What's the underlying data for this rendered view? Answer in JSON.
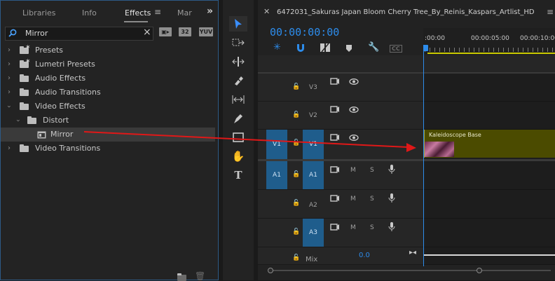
{
  "effects_panel": {
    "tabs": [
      "Libraries",
      "Info",
      "Effects",
      "Mar"
    ],
    "overflow_icon": "chevrons-right",
    "search": {
      "value": "Mirror",
      "clear": "×"
    },
    "badges": [
      "32",
      "YUV"
    ],
    "tree": [
      {
        "label": "Presets",
        "type": "folder-star",
        "expanded": false
      },
      {
        "label": "Lumetri Presets",
        "type": "folder-star",
        "expanded": false
      },
      {
        "label": "Audio Effects",
        "type": "folder",
        "expanded": false
      },
      {
        "label": "Audio Transitions",
        "type": "folder",
        "expanded": false
      },
      {
        "label": "Video Effects",
        "type": "folder",
        "expanded": true
      },
      {
        "label": "Distort",
        "type": "folder",
        "expanded": true
      },
      {
        "label": "Mirror",
        "type": "effect",
        "selected": true
      },
      {
        "label": "Video Transitions",
        "type": "folder",
        "expanded": false
      }
    ]
  },
  "timeline": {
    "sequence_title": "6472031_Sakuras Japan Bloom Cherry Tree_By_Reinis_Kaspars_Artlist_HD",
    "timecode": "00:00:00:00",
    "ruler": [
      ":00:00",
      "00:00:05:00",
      "00:00:10:00"
    ],
    "cc_label": "CC",
    "video_tracks": [
      {
        "name": "V3"
      },
      {
        "name": "V2"
      },
      {
        "name": "V1",
        "source": "V1",
        "targeted": true
      }
    ],
    "audio_tracks": [
      {
        "name": "A1",
        "source": "A1",
        "targeted": true,
        "m": "M",
        "s": "S"
      },
      {
        "name": "A2",
        "m": "M",
        "s": "S"
      },
      {
        "name": "A3",
        "m": "M",
        "s": "S"
      }
    ],
    "mix": {
      "label": "Mix",
      "value": "0.0"
    },
    "clip": {
      "name": "Kaleidoscope Base"
    }
  },
  "colors": {
    "accent": "#2d8ceb",
    "clip": "#4b4b00",
    "arrow": "#e01818"
  }
}
